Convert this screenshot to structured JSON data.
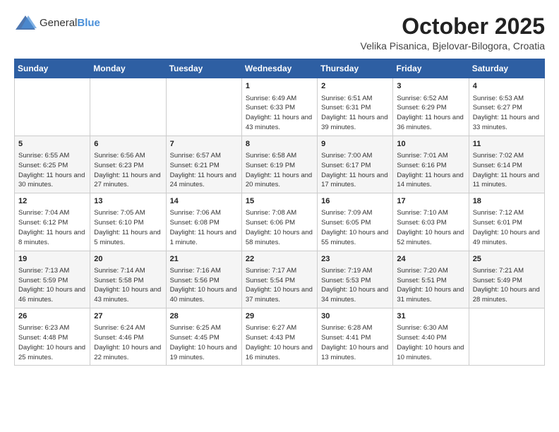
{
  "header": {
    "logo_general": "General",
    "logo_blue": "Blue",
    "month": "October 2025",
    "location": "Velika Pisanica, Bjelovar-Bilogora, Croatia"
  },
  "weekdays": [
    "Sunday",
    "Monday",
    "Tuesday",
    "Wednesday",
    "Thursday",
    "Friday",
    "Saturday"
  ],
  "weeks": [
    [
      {
        "day": "",
        "info": ""
      },
      {
        "day": "",
        "info": ""
      },
      {
        "day": "",
        "info": ""
      },
      {
        "day": "1",
        "info": "Sunrise: 6:49 AM\nSunset: 6:33 PM\nDaylight: 11 hours\nand 43 minutes."
      },
      {
        "day": "2",
        "info": "Sunrise: 6:51 AM\nSunset: 6:31 PM\nDaylight: 11 hours\nand 39 minutes."
      },
      {
        "day": "3",
        "info": "Sunrise: 6:52 AM\nSunset: 6:29 PM\nDaylight: 11 hours\nand 36 minutes."
      },
      {
        "day": "4",
        "info": "Sunrise: 6:53 AM\nSunset: 6:27 PM\nDaylight: 11 hours\nand 33 minutes."
      }
    ],
    [
      {
        "day": "5",
        "info": "Sunrise: 6:55 AM\nSunset: 6:25 PM\nDaylight: 11 hours\nand 30 minutes."
      },
      {
        "day": "6",
        "info": "Sunrise: 6:56 AM\nSunset: 6:23 PM\nDaylight: 11 hours\nand 27 minutes."
      },
      {
        "day": "7",
        "info": "Sunrise: 6:57 AM\nSunset: 6:21 PM\nDaylight: 11 hours\nand 24 minutes."
      },
      {
        "day": "8",
        "info": "Sunrise: 6:58 AM\nSunset: 6:19 PM\nDaylight: 11 hours\nand 20 minutes."
      },
      {
        "day": "9",
        "info": "Sunrise: 7:00 AM\nSunset: 6:17 PM\nDaylight: 11 hours\nand 17 minutes."
      },
      {
        "day": "10",
        "info": "Sunrise: 7:01 AM\nSunset: 6:16 PM\nDaylight: 11 hours\nand 14 minutes."
      },
      {
        "day": "11",
        "info": "Sunrise: 7:02 AM\nSunset: 6:14 PM\nDaylight: 11 hours\nand 11 minutes."
      }
    ],
    [
      {
        "day": "12",
        "info": "Sunrise: 7:04 AM\nSunset: 6:12 PM\nDaylight: 11 hours\nand 8 minutes."
      },
      {
        "day": "13",
        "info": "Sunrise: 7:05 AM\nSunset: 6:10 PM\nDaylight: 11 hours\nand 5 minutes."
      },
      {
        "day": "14",
        "info": "Sunrise: 7:06 AM\nSunset: 6:08 PM\nDaylight: 11 hours\nand 1 minute."
      },
      {
        "day": "15",
        "info": "Sunrise: 7:08 AM\nSunset: 6:06 PM\nDaylight: 10 hours\nand 58 minutes."
      },
      {
        "day": "16",
        "info": "Sunrise: 7:09 AM\nSunset: 6:05 PM\nDaylight: 10 hours\nand 55 minutes."
      },
      {
        "day": "17",
        "info": "Sunrise: 7:10 AM\nSunset: 6:03 PM\nDaylight: 10 hours\nand 52 minutes."
      },
      {
        "day": "18",
        "info": "Sunrise: 7:12 AM\nSunset: 6:01 PM\nDaylight: 10 hours\nand 49 minutes."
      }
    ],
    [
      {
        "day": "19",
        "info": "Sunrise: 7:13 AM\nSunset: 5:59 PM\nDaylight: 10 hours\nand 46 minutes."
      },
      {
        "day": "20",
        "info": "Sunrise: 7:14 AM\nSunset: 5:58 PM\nDaylight: 10 hours\nand 43 minutes."
      },
      {
        "day": "21",
        "info": "Sunrise: 7:16 AM\nSunset: 5:56 PM\nDaylight: 10 hours\nand 40 minutes."
      },
      {
        "day": "22",
        "info": "Sunrise: 7:17 AM\nSunset: 5:54 PM\nDaylight: 10 hours\nand 37 minutes."
      },
      {
        "day": "23",
        "info": "Sunrise: 7:19 AM\nSunset: 5:53 PM\nDaylight: 10 hours\nand 34 minutes."
      },
      {
        "day": "24",
        "info": "Sunrise: 7:20 AM\nSunset: 5:51 PM\nDaylight: 10 hours\nand 31 minutes."
      },
      {
        "day": "25",
        "info": "Sunrise: 7:21 AM\nSunset: 5:49 PM\nDaylight: 10 hours\nand 28 minutes."
      }
    ],
    [
      {
        "day": "26",
        "info": "Sunrise: 6:23 AM\nSunset: 4:48 PM\nDaylight: 10 hours\nand 25 minutes."
      },
      {
        "day": "27",
        "info": "Sunrise: 6:24 AM\nSunset: 4:46 PM\nDaylight: 10 hours\nand 22 minutes."
      },
      {
        "day": "28",
        "info": "Sunrise: 6:25 AM\nSunset: 4:45 PM\nDaylight: 10 hours\nand 19 minutes."
      },
      {
        "day": "29",
        "info": "Sunrise: 6:27 AM\nSunset: 4:43 PM\nDaylight: 10 hours\nand 16 minutes."
      },
      {
        "day": "30",
        "info": "Sunrise: 6:28 AM\nSunset: 4:41 PM\nDaylight: 10 hours\nand 13 minutes."
      },
      {
        "day": "31",
        "info": "Sunrise: 6:30 AM\nSunset: 4:40 PM\nDaylight: 10 hours\nand 10 minutes."
      },
      {
        "day": "",
        "info": ""
      }
    ]
  ]
}
